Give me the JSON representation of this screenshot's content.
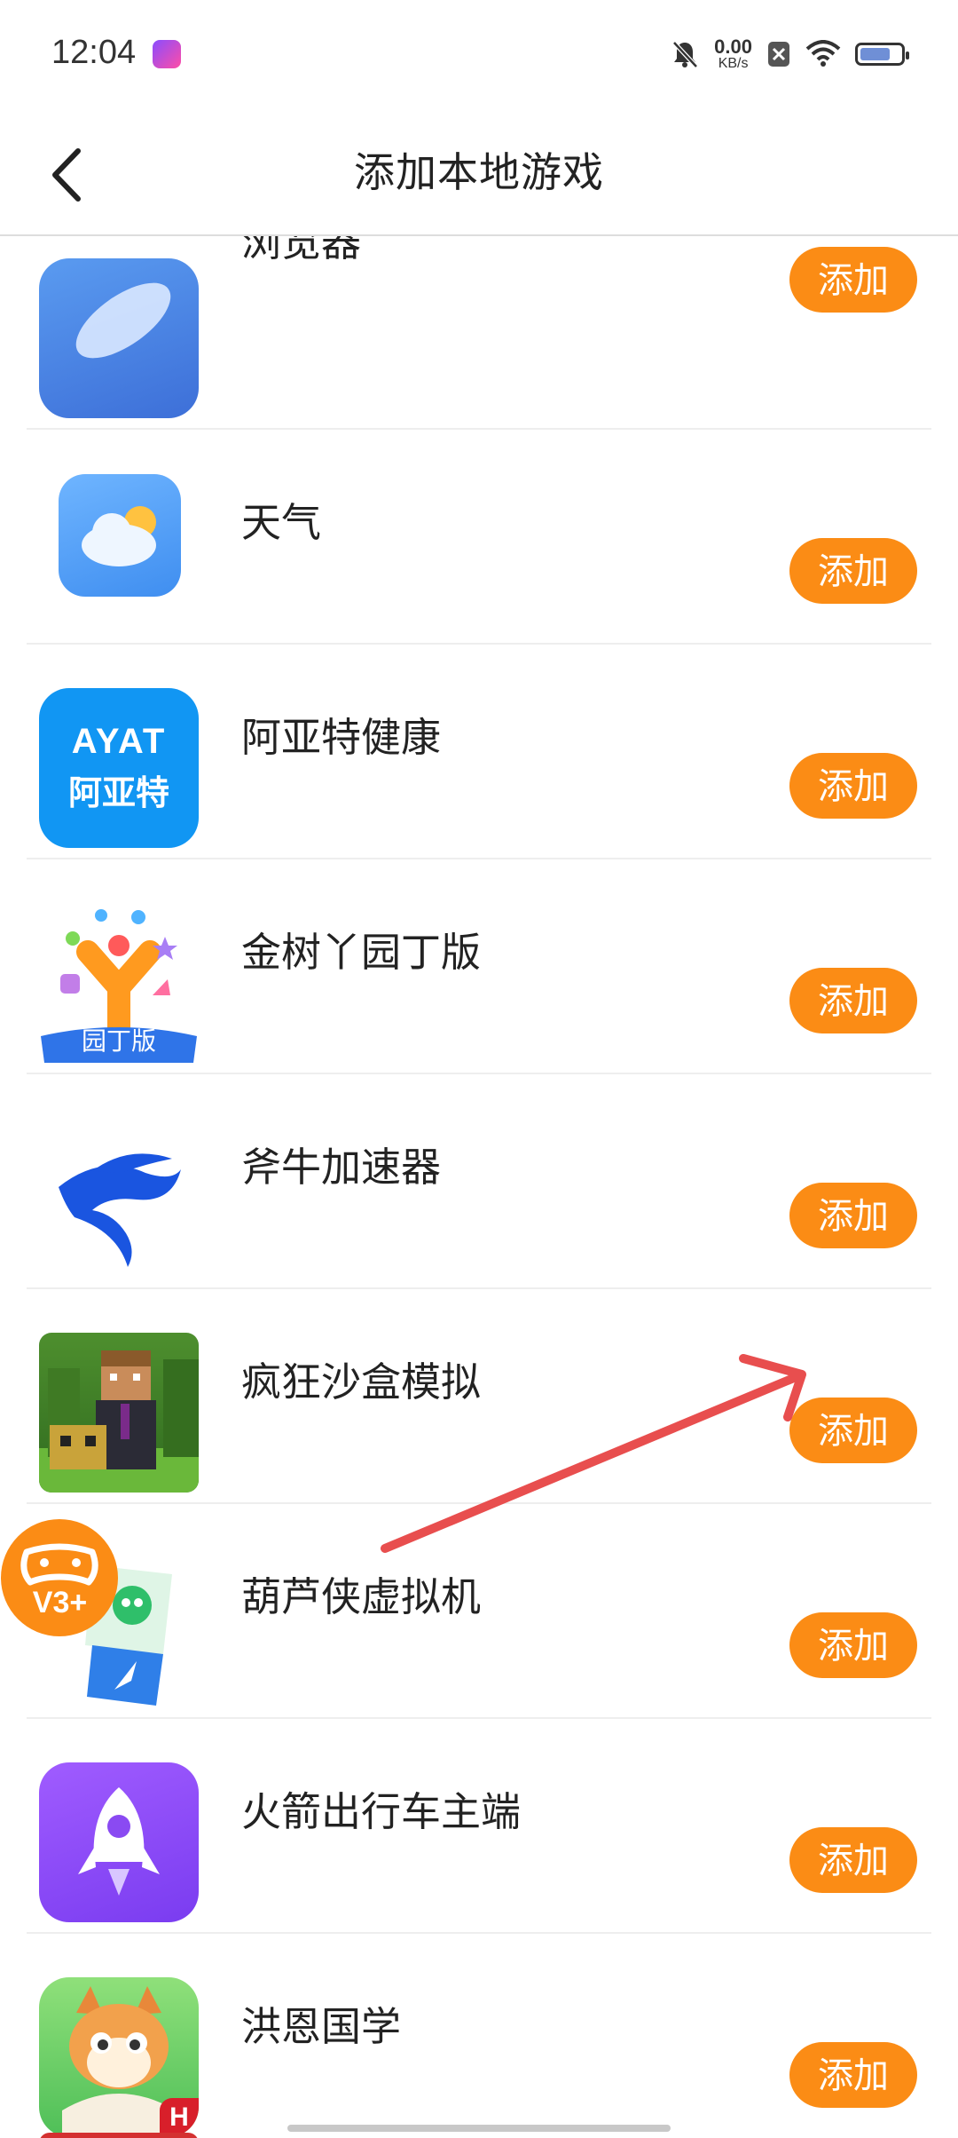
{
  "status_bar": {
    "time": "12:04",
    "net_speed_value": "0.00",
    "net_speed_unit": "KB/s",
    "battery_level": 0.75
  },
  "header": {
    "title": "添加本地游戏"
  },
  "apps": [
    {
      "name": "浏览器",
      "button": "添加"
    },
    {
      "name": "天气",
      "button": "添加"
    },
    {
      "name": "阿亚特健康",
      "button": "添加",
      "icon_text_top": "AYAT",
      "icon_text_bottom": "阿亚特"
    },
    {
      "name": "金树丫园丁版",
      "button": "添加",
      "icon_text": "园丁版"
    },
    {
      "name": "斧牛加速器",
      "button": "添加"
    },
    {
      "name": "疯狂沙盒模拟",
      "button": "添加"
    },
    {
      "name": "葫芦侠虚拟机",
      "button": "添加"
    },
    {
      "name": "火箭出行车主端",
      "button": "添加"
    },
    {
      "name": "洪恩国学",
      "button": "添加",
      "icon_badge": "H"
    }
  ],
  "floating_button": {
    "label": "V3+"
  },
  "colors": {
    "accent": "#fb8c15"
  }
}
